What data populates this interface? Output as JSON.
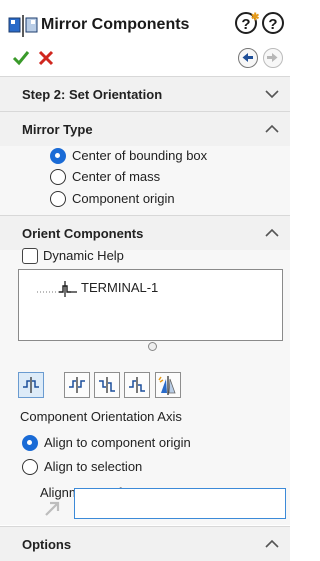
{
  "title": "Mirror Components",
  "step": {
    "label": "Step 2: Set Orientation"
  },
  "mirror_type": {
    "label": "Mirror Type",
    "options": [
      {
        "label": "Center of bounding box",
        "selected": true
      },
      {
        "label": "Center of mass",
        "selected": false
      },
      {
        "label": "Component origin",
        "selected": false
      }
    ]
  },
  "orient_components": {
    "label": "Orient Components",
    "dynamic_help": {
      "label": "Dynamic Help",
      "checked": false
    },
    "tree_item": "TERMINAL-1",
    "axis_label": "Component Orientation Axis",
    "axis_options": [
      {
        "label": "Align to component origin",
        "selected": true
      },
      {
        "label": "Align to selection",
        "selected": false
      }
    ],
    "alignment_reference_label": "Alignment Reference",
    "alignment_reference_value": ""
  },
  "options": {
    "label": "Options"
  },
  "colors": {
    "accent": "#1a6bd6",
    "ok": "#3a9a2a",
    "cancel": "#d0271f"
  }
}
